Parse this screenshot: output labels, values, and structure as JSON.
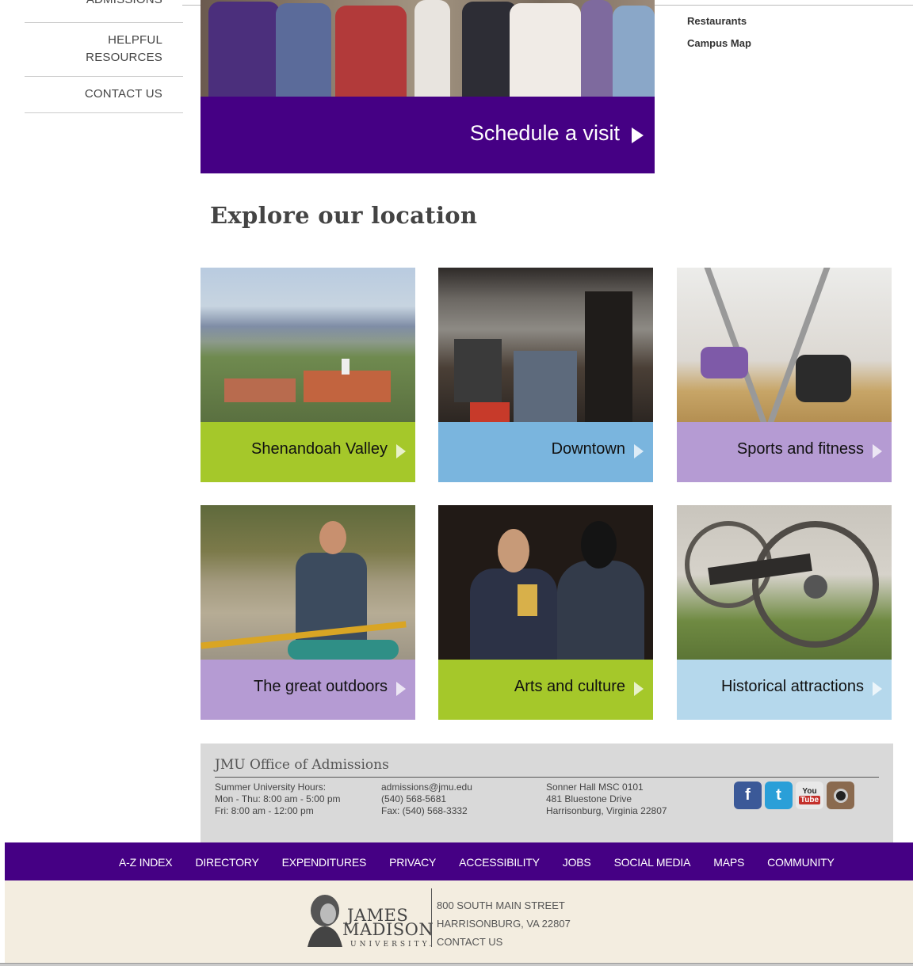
{
  "left_nav": {
    "cut_item": "ADMISSIONS",
    "helpful_line1": "HELPFUL",
    "helpful_line2": "RESOURCES",
    "contact": "CONTACT US"
  },
  "hero": {
    "cta": "Schedule a visit"
  },
  "right_links": [
    "Restaurants",
    "Campus Map"
  ],
  "explore_heading": "Explore our location",
  "tiles": [
    {
      "label": "Shenandoah Valley",
      "color": "#a5c82a"
    },
    {
      "label": "Downtown",
      "color": "#7ab5de"
    },
    {
      "label": "Sports and fitness",
      "color": "#b59bd3"
    },
    {
      "label": "The great outdoors",
      "color": "#b59bd3"
    },
    {
      "label": "Arts and culture",
      "color": "#a5c82a"
    },
    {
      "label": "Historical attractions",
      "color": "#b5d8ec"
    }
  ],
  "footer": {
    "title": "JMU Office of Admissions",
    "hours": [
      "Summer University Hours:",
      "Mon - Thu: 8:00 am - 5:00 pm",
      "Fri: 8:00 am - 12:00 pm"
    ],
    "contact": [
      "admissions@jmu.edu",
      "(540) 568-5681",
      "Fax: (540) 568-3332"
    ],
    "address": [
      "Sonner Hall MSC 0101",
      "481 Bluestone Drive",
      "Harrisonburg, Virginia 22807"
    ],
    "social": {
      "facebook": "f",
      "twitter": "t",
      "youtube_top": "You",
      "youtube_bottom": "Tube"
    }
  },
  "bottom_nav": [
    "A-Z INDEX",
    "DIRECTORY",
    "EXPENDITURES",
    "PRIVACY",
    "ACCESSIBILITY",
    "JOBS",
    "SOCIAL MEDIA",
    "MAPS",
    "COMMUNITY"
  ],
  "bottom_address": {
    "logo_line1": "JAMES",
    "logo_line2": "MADISON",
    "logo_line3": "UNIVERSITY.",
    "line1": "800 SOUTH MAIN STREET",
    "line2": "HARRISONBURG, VA 22807",
    "line3": "CONTACT US"
  },
  "colors": {
    "jmu_purple": "#450084",
    "footer_grey": "#d9d9d9",
    "cream": "#f3ede0"
  }
}
